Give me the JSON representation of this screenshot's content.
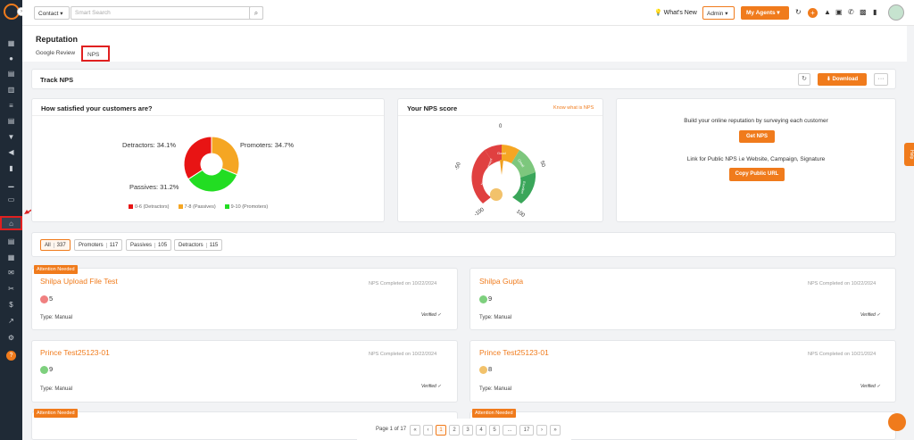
{
  "topbar": {
    "contact_select": "Contact",
    "search_placeholder": "Smart Search",
    "whats_new": "What's New",
    "admin_select": "Admin",
    "my_agents": "My Agents"
  },
  "page": {
    "title": "Reputation",
    "tabs": [
      "Google Review",
      "NPS"
    ]
  },
  "track": {
    "title": "Track NPS",
    "download_label": "Download"
  },
  "satisfaction": {
    "title": "How satisfied your customers are?",
    "legend": [
      "0-6 (Detractors)",
      "7-8 (Passives)",
      "9-10 (Promoters)"
    ],
    "labels": {
      "detractors": "Detractors: 34.1%",
      "promoters": "Promoters: 34.7%",
      "passives": "Passives: 31.2%"
    }
  },
  "chart_data": {
    "type": "pie",
    "categories": [
      "Detractors",
      "Passives",
      "Promoters"
    ],
    "values": [
      34.1,
      31.2,
      34.7
    ],
    "colors": [
      "#e81414",
      "#f5a623",
      "#22dd22"
    ]
  },
  "nps_score": {
    "title": "Your NPS score",
    "know_link": "Know what is NPS",
    "gauge_ticks": [
      "0",
      "-50",
      "50",
      "-100",
      "100"
    ],
    "gauge_segments": [
      "Needs Improvement",
      "Good",
      "Great",
      "Excellent"
    ]
  },
  "build": {
    "text1": "Build your online reputation by surveying each customer",
    "get_nps": "Get NPS",
    "text2": "Link for Public NPS i.e Website, Campaign, Signature",
    "copy_url": "Copy Public URL"
  },
  "filters": [
    {
      "label": "All",
      "count": "337"
    },
    {
      "label": "Promoters",
      "count": "117"
    },
    {
      "label": "Passives",
      "count": "105"
    },
    {
      "label": "Detractors",
      "count": "115"
    }
  ],
  "records": [
    {
      "badge": "Attention Needed",
      "name": "Shilpa Upload File Test",
      "date": "NPS Completed on 10/22/2024",
      "score": "5",
      "type": "Type: Manual",
      "face": "#f08080"
    },
    {
      "badge": "",
      "name": "Shilpa Gupta",
      "date": "NPS Completed on 10/22/2024",
      "score": "9",
      "type": "Type: Manual",
      "face": "#7ed07e"
    },
    {
      "badge": "",
      "name": "Prince Test25123-01",
      "date": "NPS Completed on 10/22/2024",
      "score": "9",
      "type": "Type: Manual",
      "face": "#7ed07e"
    },
    {
      "badge": "",
      "name": "Prince Test25123-01",
      "date": "NPS Completed on 10/21/2024",
      "score": "8",
      "type": "Type: Manual",
      "face": "#f2c26b"
    },
    {
      "badge": "Attention Needed",
      "name": "",
      "date": "",
      "score": "",
      "type": "",
      "face": ""
    },
    {
      "badge": "Attention Needed",
      "name": "",
      "date": "",
      "score": "",
      "type": "",
      "face": ""
    }
  ],
  "pagination": {
    "label": "Page 1 of 17",
    "pages": [
      "«",
      "‹",
      "1",
      "2",
      "3",
      "4",
      "5",
      "...",
      "17",
      "›",
      "»"
    ]
  }
}
